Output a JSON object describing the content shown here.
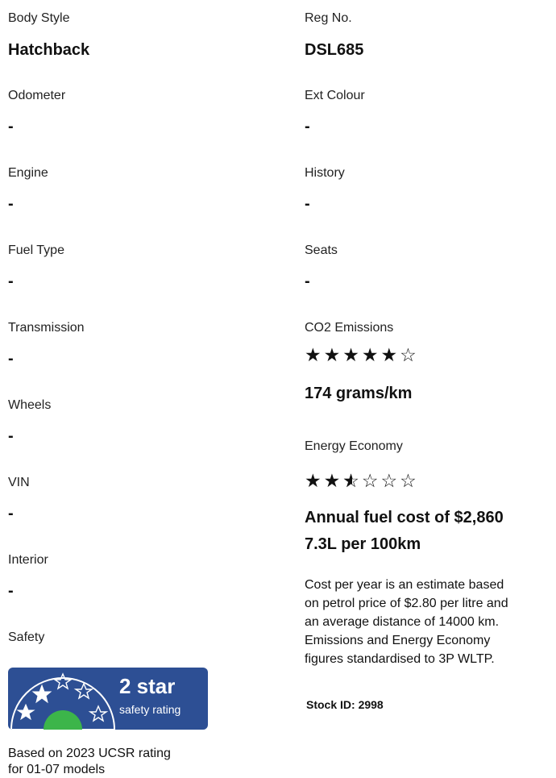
{
  "specs_left": [
    {
      "label": "Body Style",
      "value": "Hatchback"
    },
    {
      "label": "Odometer",
      "value": "-"
    },
    {
      "label": "Engine",
      "value": "-"
    },
    {
      "label": "Fuel Type",
      "value": "-"
    },
    {
      "label": "Transmission",
      "value": "-"
    },
    {
      "label": "Wheels",
      "value": "-"
    },
    {
      "label": "VIN",
      "value": "-"
    },
    {
      "label": "Interior",
      "value": "-"
    }
  ],
  "specs_right": [
    {
      "label": "Reg No.",
      "value": "DSL685"
    },
    {
      "label": "Ext Colour",
      "value": "-"
    },
    {
      "label": "History",
      "value": "-"
    },
    {
      "label": "Seats",
      "value": "-"
    }
  ],
  "safety": {
    "label": "Safety",
    "badge_line1": "2 star",
    "badge_line2": "safety rating",
    "rating_stars": 2,
    "note_line1": "Based on 2023 UCSR rating",
    "note_line2": "for 01-07 models"
  },
  "co2": {
    "label": "CO2 Emissions",
    "rating_stars": 5,
    "rating_max": 6,
    "value": "174 grams/km"
  },
  "energy": {
    "label": "Energy Economy",
    "rating_stars": 2.5,
    "rating_max": 6,
    "annual_cost": "Annual fuel cost of $2,860",
    "consumption": "7.3L per 100km"
  },
  "disclaimer": [
    "Cost per year is an estimate based",
    "on petrol price of  $2.80 per litre and",
    "an average distance of 14000 km.",
    "Emissions and Energy Economy",
    "figures standardised to 3P WLTP."
  ],
  "stock_id": "Stock ID: 2998",
  "colors": {
    "badge_background": "#2d4f94",
    "badge_dial_green": "#3cb54a",
    "star_color": "#111111"
  }
}
